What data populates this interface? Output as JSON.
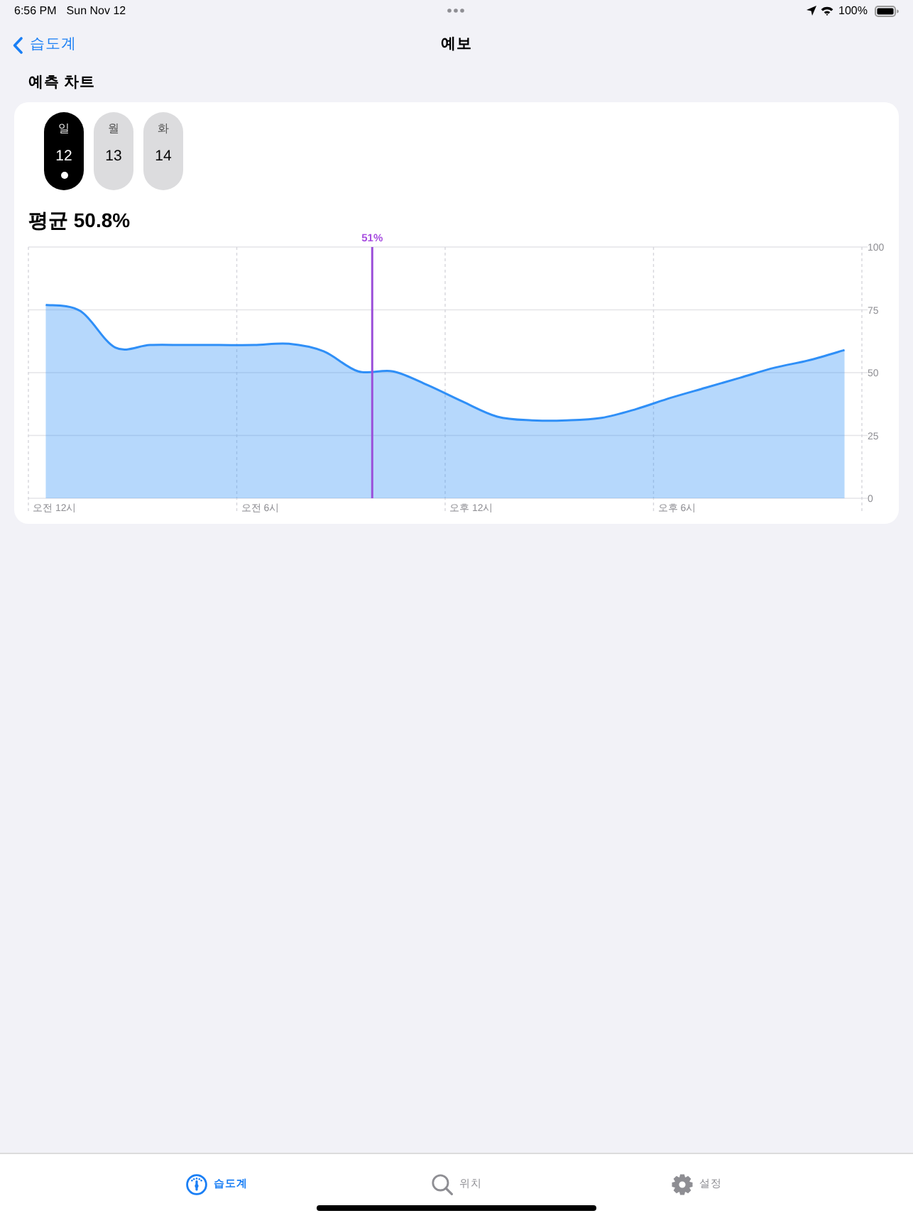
{
  "status_bar": {
    "time": "6:56 PM",
    "date": "Sun Nov 12",
    "battery": "100%"
  },
  "nav_bar": {
    "back_label": "습도계",
    "title": "예보"
  },
  "section_title": "예측 차트",
  "day_picker": [
    {
      "weekday": "일",
      "day": "12",
      "selected": true,
      "today": true
    },
    {
      "weekday": "월",
      "day": "13",
      "selected": false,
      "today": false
    },
    {
      "weekday": "화",
      "day": "14",
      "selected": false,
      "today": false
    }
  ],
  "chart": {
    "chart_data": {
      "type": "area",
      "title": "평균 50.8%",
      "categories": [
        "오전 12시",
        null,
        null,
        null,
        null,
        null,
        "오전 6시",
        null,
        null,
        null,
        null,
        null,
        "오후 12시",
        null,
        null,
        null,
        null,
        null,
        "오후 6시",
        null,
        null,
        null,
        null,
        null
      ],
      "series": [
        {
          "color": "#2f8ff7",
          "values": [
            77,
            74.5,
            60,
            61,
            61,
            61,
            61,
            61.5,
            58.5,
            50.5,
            50.5,
            45,
            38.5,
            32.5,
            31,
            31,
            32,
            35.5,
            40,
            44,
            48,
            52,
            55,
            59
          ]
        }
      ],
      "ylim": [
        0,
        100
      ],
      "yticks": [
        0,
        25,
        50,
        75,
        100
      ],
      "grid": true,
      "annotations": [
        "51%"
      ]
    }
  },
  "tab_bar": [
    {
      "label": "습도계",
      "selected": true
    },
    {
      "label": "위치",
      "selected": false
    },
    {
      "label": "설정",
      "selected": false
    }
  ]
}
